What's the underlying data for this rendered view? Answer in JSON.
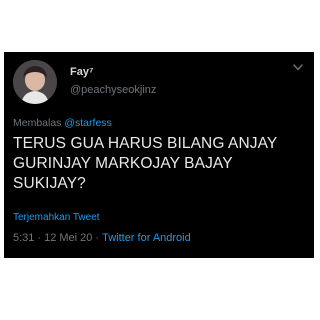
{
  "tweet": {
    "display_name": "Fay⁷",
    "handle": "@peachyseokjinz",
    "reply_prefix": "Membalas",
    "reply_mention": "@starfess",
    "text": "TERUS GUA HARUS BILANG ANJAY GURINJAY MARKOJAY BAJAY SUKIJAY?",
    "translate_label": "Terjemahkan Tweet",
    "time": "5:31",
    "date": "12 Mei 20",
    "source": "Twitter for Android",
    "icons": {
      "more": "chevron-down-icon",
      "avatar": "profile-avatar"
    },
    "colors": {
      "background": "#000000",
      "accent": "#1d9bf0",
      "text": "#e7e9ea",
      "muted": "#6e767d"
    }
  }
}
